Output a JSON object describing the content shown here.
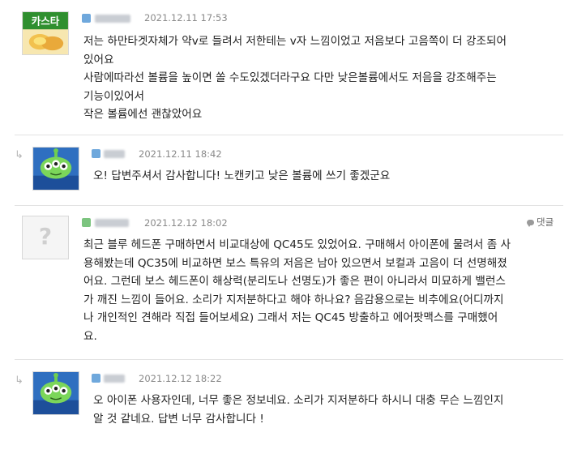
{
  "comments": [
    {
      "timestamp": "2021.12.11 17:53",
      "avatar_text": "카스타",
      "body": "저는 하만타겟자체가 약v로 들려서 저한테는 v자 느낌이었고 저음보다 고음쪽이 더 강조되어\n있어요\n사람에따라선 볼륨을 높이면 쏠 수도있겠더라구요 다만 낮은볼륨에서도 저음을 강조해주는\n기능이있어서\n작은 볼륨에선 괜찮았어요"
    },
    {
      "timestamp": "2021.12.11 18:42",
      "body": "오! 답변주셔서 감사합니다! 노캔키고 낮은 볼륨에 쓰기 좋겠군요"
    },
    {
      "timestamp": "2021.12.12 18:02",
      "avatar_text": "?",
      "reply_label": "댓글",
      "body": "최근 블루 헤드폰 구매하면서 비교대상에 QC45도 있었어요. 구매해서 아이폰에 물려서 좀 사\n용해봤는데 QC35에 비교하면 보스 특유의 저음은 남아 있으면서 보컬과 고음이 더 선명해졌\n어요. 그런데 보스 헤드폰이 해상력(분리도나 선명도)가 좋은 편이 아니라서 미묘하게 밸런스\n가 깨진 느낌이 들어요. 소리가 지저분하다고 해야 하나요? 음감용으로는 비추에요(어디까지\n나 개인적인 견해라 직접 들어보세요) 그래서 저는 QC45 방출하고 에어팟맥스를 구매했어\n요."
    },
    {
      "timestamp": "2021.12.12 18:22",
      "body": "오 아이폰 사용자인데, 너무 좋은 정보네요. 소리가 지저분하다 하시니 대충 무슨 느낌인지\n알 것 같네요. 답변 너무 감사합니다 !"
    }
  ],
  "icons": {
    "reply_indicator": "reply-arrow-icon",
    "grade_colors": [
      "#6fa8dc",
      "#6fa8dc",
      "#7cc47f",
      "#6fa8dc"
    ]
  },
  "colors": {
    "timestamp": "#8a8a8a",
    "divider": "#e3e3e3"
  }
}
